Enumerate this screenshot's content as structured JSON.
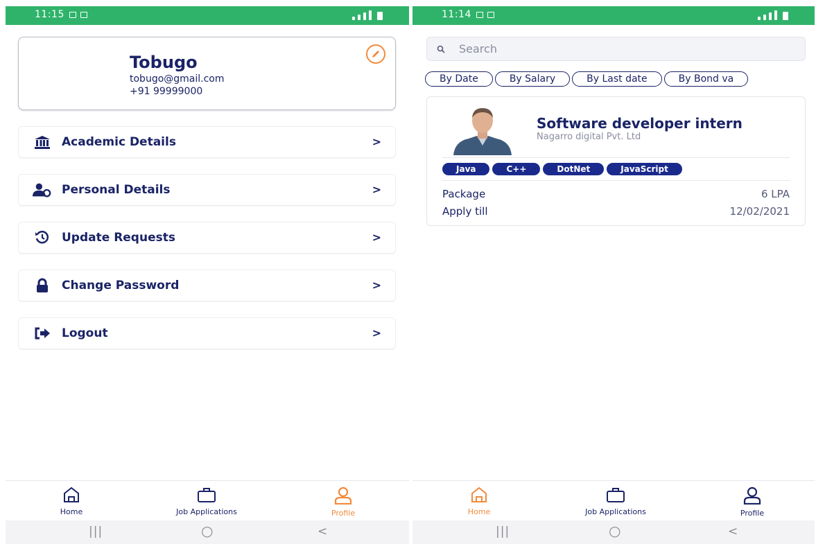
{
  "left_screen": {
    "status_bar": {
      "time": "11:15"
    },
    "profile": {
      "name": "Tobugo",
      "email": "tobugo@gmail.com",
      "phone": "+91 99999000"
    },
    "menu": [
      {
        "label": "Academic Details",
        "icon": "bank-icon"
      },
      {
        "label": "Personal Details",
        "icon": "user-shield-icon"
      },
      {
        "label": "Update Requests",
        "icon": "history-icon"
      },
      {
        "label": "Change Password",
        "icon": "lock-icon"
      },
      {
        "label": "Logout",
        "icon": "logout-icon"
      }
    ],
    "chevron": ">",
    "bottom_nav": [
      {
        "label": "Home",
        "icon": "home-icon",
        "active": false
      },
      {
        "label": "Job Applications",
        "icon": "briefcase-icon",
        "active": false
      },
      {
        "label": "Profile",
        "icon": "user-icon",
        "active": true
      }
    ]
  },
  "right_screen": {
    "status_bar": {
      "time": "11:14"
    },
    "search": {
      "placeholder": "Search"
    },
    "filters": [
      "By Date",
      "By Salary",
      "By Last date",
      "By Bond va"
    ],
    "job": {
      "title": "Software developer intern",
      "company": "Nagarro digital Pvt. Ltd",
      "skills": [
        "Java",
        "C++",
        "DotNet",
        "JavaScript"
      ],
      "package_label": "Package",
      "package_value": "6 LPA",
      "apply_label": "Apply till",
      "apply_value": "12/02/2021"
    },
    "bottom_nav": [
      {
        "label": "Home",
        "icon": "home-icon",
        "active": true
      },
      {
        "label": "Job Applications",
        "icon": "briefcase-icon",
        "active": false
      },
      {
        "label": "Profile",
        "icon": "user-icon",
        "active": false
      }
    ]
  },
  "system_nav": {
    "recent": "|||",
    "home": "○",
    "back": "<"
  },
  "colors": {
    "status_bar": "#2fb36a",
    "primary": "#1a2366",
    "accent": "#f28a3c",
    "tag_bg": "#1a2a8c"
  }
}
